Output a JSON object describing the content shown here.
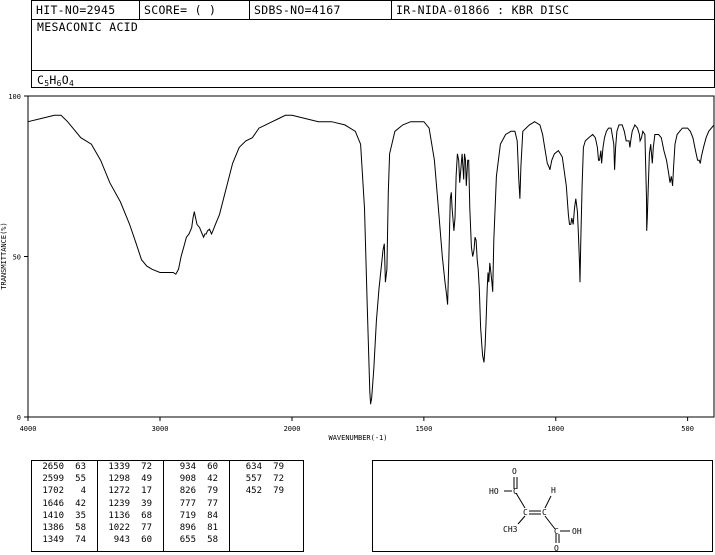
{
  "header": {
    "hit_no": "HIT-NO=2945",
    "score": "SCORE=  (   )",
    "sdbs_no": "SDBS-NO=4167",
    "ir_no": "IR-NIDA-01866 : KBR DISC"
  },
  "compound": {
    "name": "MESACONIC ACID",
    "formula": {
      "c": "C",
      "c_n": "5",
      "h": "H",
      "h_n": "6",
      "o": "O",
      "o_n": "4"
    }
  },
  "chart_data": {
    "type": "line",
    "xlabel": "WAVENUMBER(-1)",
    "ylabel": "TRANSMITTANCE(%)",
    "xlim": [
      4000,
      400
    ],
    "ylim": [
      0,
      100
    ],
    "x_ticks": [
      "4000",
      "3000",
      "2000",
      "1500",
      "1000",
      "500"
    ],
    "y_ticks": [
      "100",
      "50",
      "0"
    ],
    "x_tick_values": [
      4000,
      3000,
      2000,
      1500,
      1000,
      500
    ],
    "y_tick_values": [
      100,
      50,
      0
    ],
    "series": [
      {
        "color": "#000000",
        "points": [
          [
            4000,
            92
          ],
          [
            3900,
            93
          ],
          [
            3800,
            94
          ],
          [
            3750,
            94
          ],
          [
            3700,
            92
          ],
          [
            3600,
            87
          ],
          [
            3520,
            85
          ],
          [
            3450,
            80
          ],
          [
            3380,
            73
          ],
          [
            3300,
            67
          ],
          [
            3230,
            60
          ],
          [
            3180,
            54
          ],
          [
            3140,
            49
          ],
          [
            3100,
            47
          ],
          [
            3060,
            46
          ],
          [
            3000,
            45
          ],
          [
            2950,
            45
          ],
          [
            2900,
            45
          ],
          [
            2880,
            44.5
          ],
          [
            2860,
            46
          ],
          [
            2840,
            50
          ],
          [
            2820,
            53
          ],
          [
            2800,
            56
          ],
          [
            2780,
            57
          ],
          [
            2760,
            59
          ],
          [
            2750,
            62
          ],
          [
            2740,
            64
          ],
          [
            2730,
            62
          ],
          [
            2720,
            60
          ],
          [
            2700,
            59
          ],
          [
            2680,
            57
          ],
          [
            2670,
            56
          ],
          [
            2660,
            57
          ],
          [
            2650,
            57
          ],
          [
            2640,
            58
          ],
          [
            2625,
            58.5
          ],
          [
            2610,
            57
          ],
          [
            2599,
            58
          ],
          [
            2580,
            60
          ],
          [
            2550,
            63
          ],
          [
            2500,
            71
          ],
          [
            2450,
            79
          ],
          [
            2400,
            84
          ],
          [
            2350,
            86
          ],
          [
            2300,
            87
          ],
          [
            2250,
            90
          ],
          [
            2200,
            91
          ],
          [
            2150,
            92
          ],
          [
            2100,
            93
          ],
          [
            2050,
            94
          ],
          [
            2000,
            94
          ],
          [
            1950,
            93
          ],
          [
            1900,
            92
          ],
          [
            1850,
            92
          ],
          [
            1800,
            91
          ],
          [
            1760,
            89
          ],
          [
            1740,
            85
          ],
          [
            1725,
            65
          ],
          [
            1715,
            35
          ],
          [
            1705,
            8
          ],
          [
            1702,
            4
          ],
          [
            1698,
            6
          ],
          [
            1690,
            15
          ],
          [
            1680,
            30
          ],
          [
            1670,
            40
          ],
          [
            1660,
            48
          ],
          [
            1655,
            52
          ],
          [
            1650,
            54
          ],
          [
            1646,
            42
          ],
          [
            1640,
            46
          ],
          [
            1635,
            70
          ],
          [
            1630,
            82
          ],
          [
            1610,
            89
          ],
          [
            1580,
            91
          ],
          [
            1550,
            92
          ],
          [
            1520,
            92
          ],
          [
            1500,
            92
          ],
          [
            1480,
            90
          ],
          [
            1460,
            80
          ],
          [
            1445,
            65
          ],
          [
            1430,
            50
          ],
          [
            1420,
            42
          ],
          [
            1414,
            38
          ],
          [
            1410,
            35
          ],
          [
            1405,
            50
          ],
          [
            1400,
            68
          ],
          [
            1396,
            70
          ],
          [
            1393,
            65
          ],
          [
            1390,
            62
          ],
          [
            1386,
            58
          ],
          [
            1382,
            62
          ],
          [
            1378,
            75
          ],
          [
            1373,
            82
          ],
          [
            1368,
            80
          ],
          [
            1364,
            73
          ],
          [
            1360,
            77
          ],
          [
            1355,
            82
          ],
          [
            1349,
            74
          ],
          [
            1346,
            82
          ],
          [
            1342,
            80
          ],
          [
            1339,
            72
          ],
          [
            1334,
            80
          ],
          [
            1330,
            80
          ],
          [
            1326,
            65
          ],
          [
            1320,
            53
          ],
          [
            1315,
            50
          ],
          [
            1310,
            52
          ],
          [
            1306,
            56
          ],
          [
            1302,
            55
          ],
          [
            1298,
            49
          ],
          [
            1294,
            46
          ],
          [
            1290,
            40
          ],
          [
            1285,
            28
          ],
          [
            1280,
            22
          ],
          [
            1277,
            19
          ],
          [
            1272,
            17
          ],
          [
            1268,
            22
          ],
          [
            1264,
            30
          ],
          [
            1260,
            40
          ],
          [
            1257,
            45
          ],
          [
            1254,
            42
          ],
          [
            1250,
            48
          ],
          [
            1246,
            45
          ],
          [
            1242,
            42
          ],
          [
            1239,
            39
          ],
          [
            1235,
            55
          ],
          [
            1225,
            75
          ],
          [
            1210,
            85
          ],
          [
            1190,
            88
          ],
          [
            1170,
            89
          ],
          [
            1155,
            89
          ],
          [
            1146,
            86
          ],
          [
            1140,
            74
          ],
          [
            1136,
            68
          ],
          [
            1132,
            78
          ],
          [
            1125,
            89
          ],
          [
            1100,
            91
          ],
          [
            1080,
            92
          ],
          [
            1060,
            91
          ],
          [
            1050,
            88
          ],
          [
            1040,
            83
          ],
          [
            1032,
            79
          ],
          [
            1026,
            78
          ],
          [
            1022,
            77
          ],
          [
            1015,
            80
          ],
          [
            1005,
            82
          ],
          [
            990,
            83
          ],
          [
            975,
            81
          ],
          [
            960,
            72
          ],
          [
            952,
            63
          ],
          [
            948,
            60
          ],
          [
            943,
            60
          ],
          [
            939,
            62
          ],
          [
            934,
            60
          ],
          [
            929,
            65
          ],
          [
            924,
            68
          ],
          [
            918,
            64
          ],
          [
            914,
            57
          ],
          [
            910,
            48
          ],
          [
            908,
            42
          ],
          [
            905,
            55
          ],
          [
            900,
            72
          ],
          [
            895,
            84
          ],
          [
            888,
            86
          ],
          [
            875,
            87
          ],
          [
            860,
            88
          ],
          [
            850,
            87
          ],
          [
            842,
            84
          ],
          [
            838,
            80
          ],
          [
            834,
            80
          ],
          [
            829,
            83
          ],
          [
            826,
            79
          ],
          [
            821,
            84
          ],
          [
            815,
            87
          ],
          [
            808,
            89
          ],
          [
            800,
            90
          ],
          [
            790,
            90
          ],
          [
            780,
            85
          ],
          [
            777,
            77
          ],
          [
            773,
            84
          ],
          [
            768,
            89
          ],
          [
            760,
            91
          ],
          [
            748,
            91
          ],
          [
            740,
            89
          ],
          [
            733,
            86
          ],
          [
            726,
            86
          ],
          [
            722,
            86
          ],
          [
            719,
            84
          ],
          [
            716,
            86
          ],
          [
            710,
            89
          ],
          [
            700,
            91
          ],
          [
            690,
            90
          ],
          [
            683,
            88
          ],
          [
            680,
            86
          ],
          [
            675,
            87
          ],
          [
            670,
            89
          ],
          [
            662,
            88
          ],
          [
            656,
            68
          ],
          [
            655,
            58
          ],
          [
            653,
            62
          ],
          [
            649,
            72
          ],
          [
            645,
            82
          ],
          [
            640,
            85
          ],
          [
            634,
            79
          ],
          [
            630,
            84
          ],
          [
            624,
            88
          ],
          [
            618,
            88
          ],
          [
            610,
            88
          ],
          [
            600,
            87
          ],
          [
            590,
            83
          ],
          [
            580,
            80
          ],
          [
            572,
            76
          ],
          [
            567,
            73
          ],
          [
            562,
            75
          ],
          [
            557,
            72
          ],
          [
            553,
            78
          ],
          [
            548,
            85
          ],
          [
            540,
            88
          ],
          [
            530,
            89
          ],
          [
            520,
            90
          ],
          [
            510,
            90
          ],
          [
            500,
            90
          ],
          [
            490,
            89
          ],
          [
            480,
            87
          ],
          [
            470,
            83
          ],
          [
            462,
            80
          ],
          [
            456,
            80
          ],
          [
            452,
            79
          ],
          [
            448,
            81
          ],
          [
            440,
            84
          ],
          [
            430,
            87
          ],
          [
            420,
            89
          ],
          [
            410,
            90
          ],
          [
            400,
            91
          ]
        ]
      }
    ],
    "peak_table": {
      "headers": [],
      "rows": [
        [
          [
            "2650",
            "63"
          ],
          [
            "1339",
            "72"
          ],
          [
            "934",
            "60"
          ],
          [
            "634",
            "79"
          ]
        ],
        [
          [
            "2599",
            "55"
          ],
          [
            "1298",
            "49"
          ],
          [
            "908",
            "42"
          ],
          [
            "557",
            "72"
          ]
        ],
        [
          [
            "1702",
            "4"
          ],
          [
            "1272",
            "17"
          ],
          [
            "826",
            "79"
          ],
          [
            "452",
            "79"
          ]
        ],
        [
          [
            "1646",
            "42"
          ],
          [
            "1239",
            "39"
          ],
          [
            "777",
            "77"
          ],
          [
            "",
            ""
          ]
        ],
        [
          [
            "1410",
            "35"
          ],
          [
            "1136",
            "68"
          ],
          [
            "719",
            "84"
          ],
          [
            "",
            ""
          ]
        ],
        [
          [
            "1386",
            "58"
          ],
          [
            "1022",
            "77"
          ],
          [
            "896",
            "81"
          ],
          [
            "",
            ""
          ]
        ],
        [
          [
            "1349",
            "74"
          ],
          [
            "943",
            "60"
          ],
          [
            "655",
            "58"
          ],
          [
            "",
            ""
          ]
        ]
      ]
    }
  },
  "structure": {
    "labels": {
      "o_top": "O",
      "ho": "HO",
      "h": "H",
      "ch3": "CH3",
      "oh": "OH",
      "o_bottom": "O",
      "c1": "C",
      "c2": "C",
      "c3": "C",
      "c4": "C"
    }
  }
}
